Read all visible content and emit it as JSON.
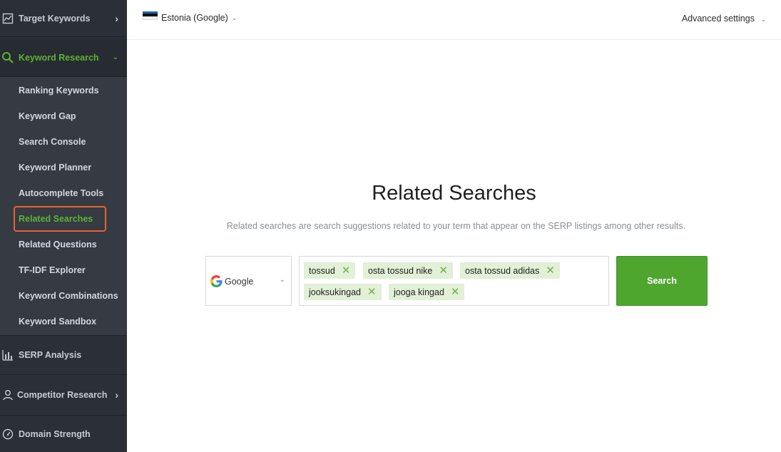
{
  "sidebar": {
    "target_keywords": "Target Keywords",
    "keyword_research": "Keyword Research",
    "submenu": [
      "Ranking Keywords",
      "Keyword Gap",
      "Search Console",
      "Keyword Planner",
      "Autocomplete Tools",
      "Related Searches",
      "Related Questions",
      "TF-IDF Explorer",
      "Keyword Combinations",
      "Keyword Sandbox"
    ],
    "active_item": "Related Searches",
    "serp_analysis": "SERP Analysis",
    "competitor_research": "Competitor Research",
    "domain_strength": "Domain Strength"
  },
  "topbar": {
    "country": "Estonia (Google)",
    "advanced_settings": "Advanced settings"
  },
  "main": {
    "title": "Related Searches",
    "description": "Related searches are search suggestions related to your term that appear on the SERP listings among other results.",
    "engine": "Google",
    "keywords": [
      "tossud",
      "osta tossud nike",
      "osta tossud adidas",
      "jooksukingad",
      "jooga kingad"
    ],
    "search_button": "Search"
  },
  "colors": {
    "sidebar_bg": "#2b3038",
    "submenu_bg": "#353a43",
    "accent_green": "#5cb334",
    "active_outline": "#e8632c",
    "search_button": "#4fa62f",
    "tag_bg": "#e1f0d6"
  },
  "icons": {
    "target_keywords": "line-chart-icon",
    "keyword_research": "search-icon",
    "serp_analysis": "bar-chart-icon",
    "competitor_research": "user-icon",
    "domain_strength": "gauge-icon"
  }
}
